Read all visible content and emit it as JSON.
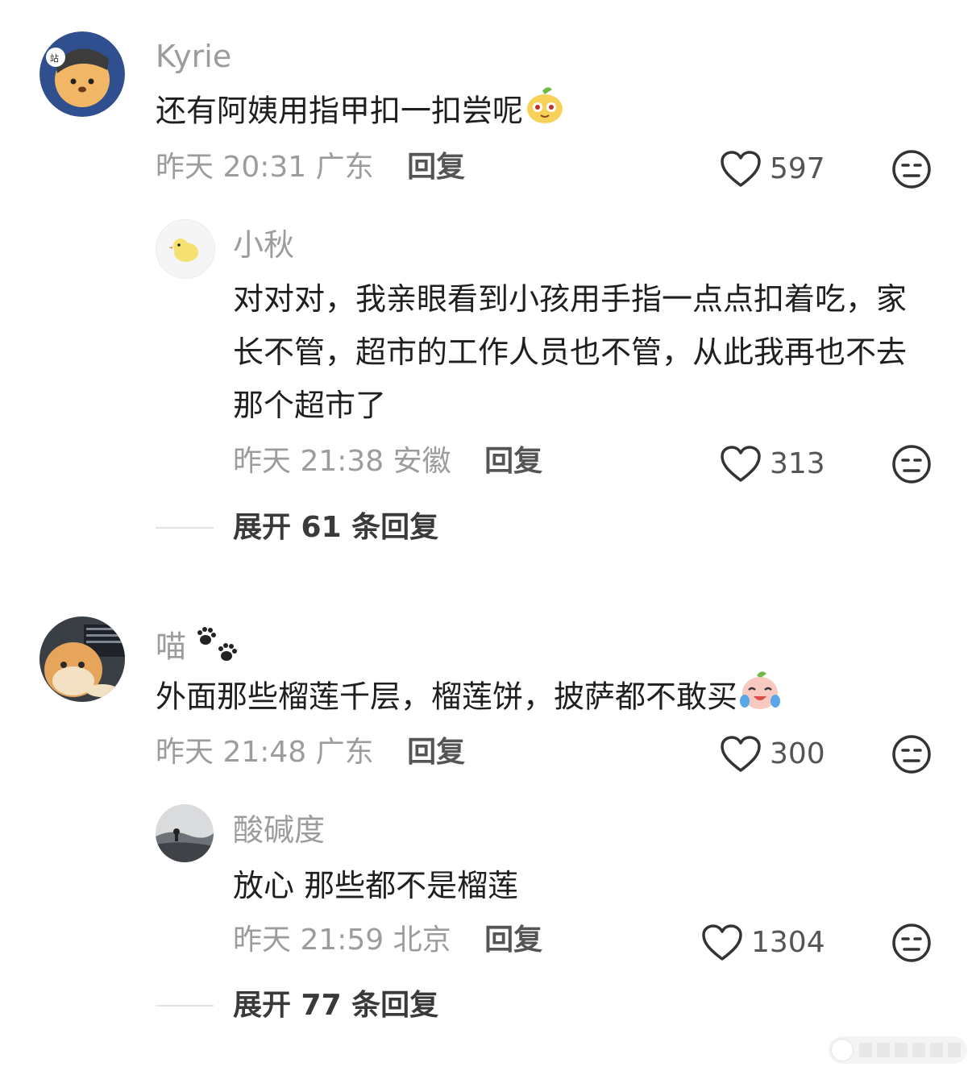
{
  "comments": [
    {
      "user": "Kyrie",
      "text": "还有阿姨用指甲扣一扣尝呢",
      "time": "昨天 20:31",
      "location": "广东",
      "reply_label": "回复",
      "likes": "597",
      "replies": [
        {
          "user": "小秋",
          "text": "对对对，我亲眼看到小孩用手指一点点扣着吃，家长不管，超市的工作人员也不管，从此我再也不去那个超市了",
          "time": "昨天 21:38",
          "location": "安徽",
          "reply_label": "回复",
          "likes": "313"
        }
      ],
      "expand_label": "展开 61 条回复"
    },
    {
      "user": "喵",
      "text": "外面那些榴莲千层，榴莲饼，披萨都不敢买",
      "time": "昨天 21:48",
      "location": "广东",
      "reply_label": "回复",
      "likes": "300",
      "replies": [
        {
          "user": "酸碱度",
          "text": "放心 那些都不是榴莲",
          "time": "昨天 21:59",
          "location": "北京",
          "reply_label": "回复",
          "likes": "1304"
        }
      ],
      "expand_label": "展开 77 条回复"
    }
  ],
  "colors": {
    "name_gray": "#9c9c9c",
    "text": "#1f1f1f",
    "icon_gray": "#333333"
  }
}
